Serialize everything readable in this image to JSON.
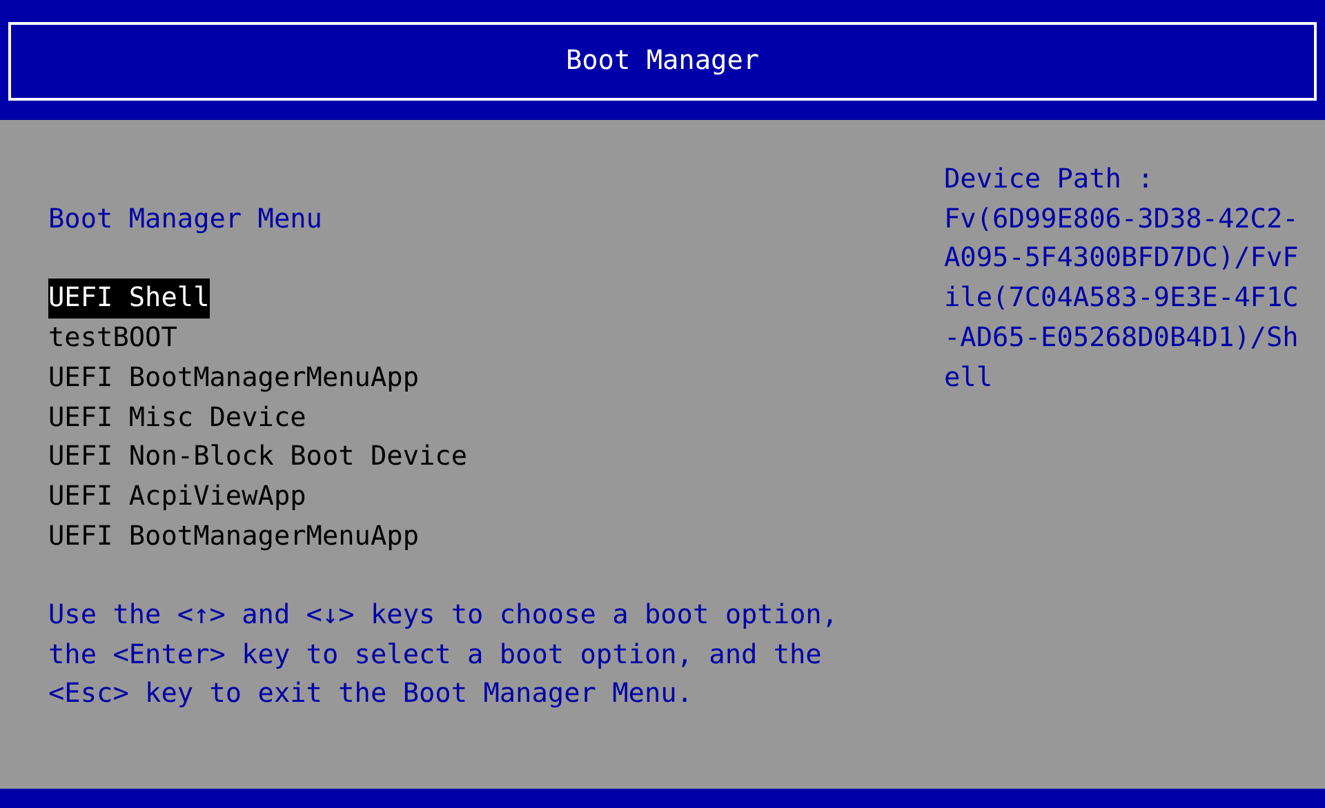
{
  "window": {
    "title": "Boot Manager"
  },
  "menu": {
    "title": "Boot Manager Menu",
    "items": [
      {
        "label": "UEFI Shell",
        "selected": true
      },
      {
        "label": "testBOOT",
        "selected": false
      },
      {
        "label": "UEFI BootManagerMenuApp",
        "selected": false
      },
      {
        "label": "UEFI Misc Device",
        "selected": false
      },
      {
        "label": "UEFI Non-Block Boot Device",
        "selected": false
      },
      {
        "label": "UEFI AcpiViewApp",
        "selected": false
      },
      {
        "label": "UEFI BootManagerMenuApp",
        "selected": false
      }
    ],
    "help": "Use the <↑> and <↓> keys to choose a boot option, the <Enter> key to select a boot option, and the <Esc> key to exit the Boot Manager Menu."
  },
  "details": {
    "label": "Device Path :",
    "value": "Fv(6D99E806-3D38-42C2-A095-5F4300BFD7DC)/FvFile(7C04A583-9E3E-4F1C-AD65-E05268D0B4D1)/Shell"
  }
}
